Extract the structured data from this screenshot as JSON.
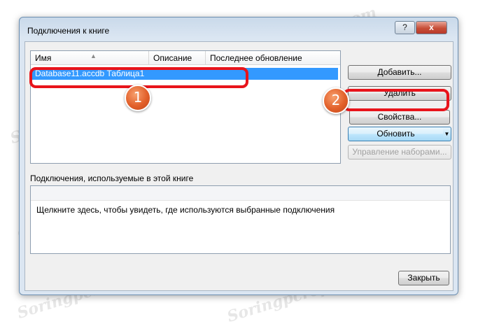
{
  "window": {
    "title": "Подключения к книге",
    "help_label": "?",
    "close_label": "x"
  },
  "list": {
    "columns": [
      "Имя",
      "Описание",
      "Последнее обновление"
    ],
    "rows": [
      {
        "name": "Database11.accdb Таблица1",
        "description": "",
        "last_refresh": ""
      }
    ]
  },
  "buttons": {
    "add": "Добавить...",
    "delete": "Удалить",
    "properties": "Свойства...",
    "refresh": "Обновить",
    "manage_sets": "Управление наборами...",
    "close": "Закрыть"
  },
  "usage": {
    "label": "Подключения, используемые в этой книге",
    "hint": "Щелкните здесь, чтобы увидеть, где используются выбранные подключения"
  },
  "annotations": {
    "badge_1": "1",
    "badge_2": "2",
    "outline_color": "#e8141b",
    "badge_color": "#e2602a"
  },
  "watermark": "Soringpcrepair.com"
}
